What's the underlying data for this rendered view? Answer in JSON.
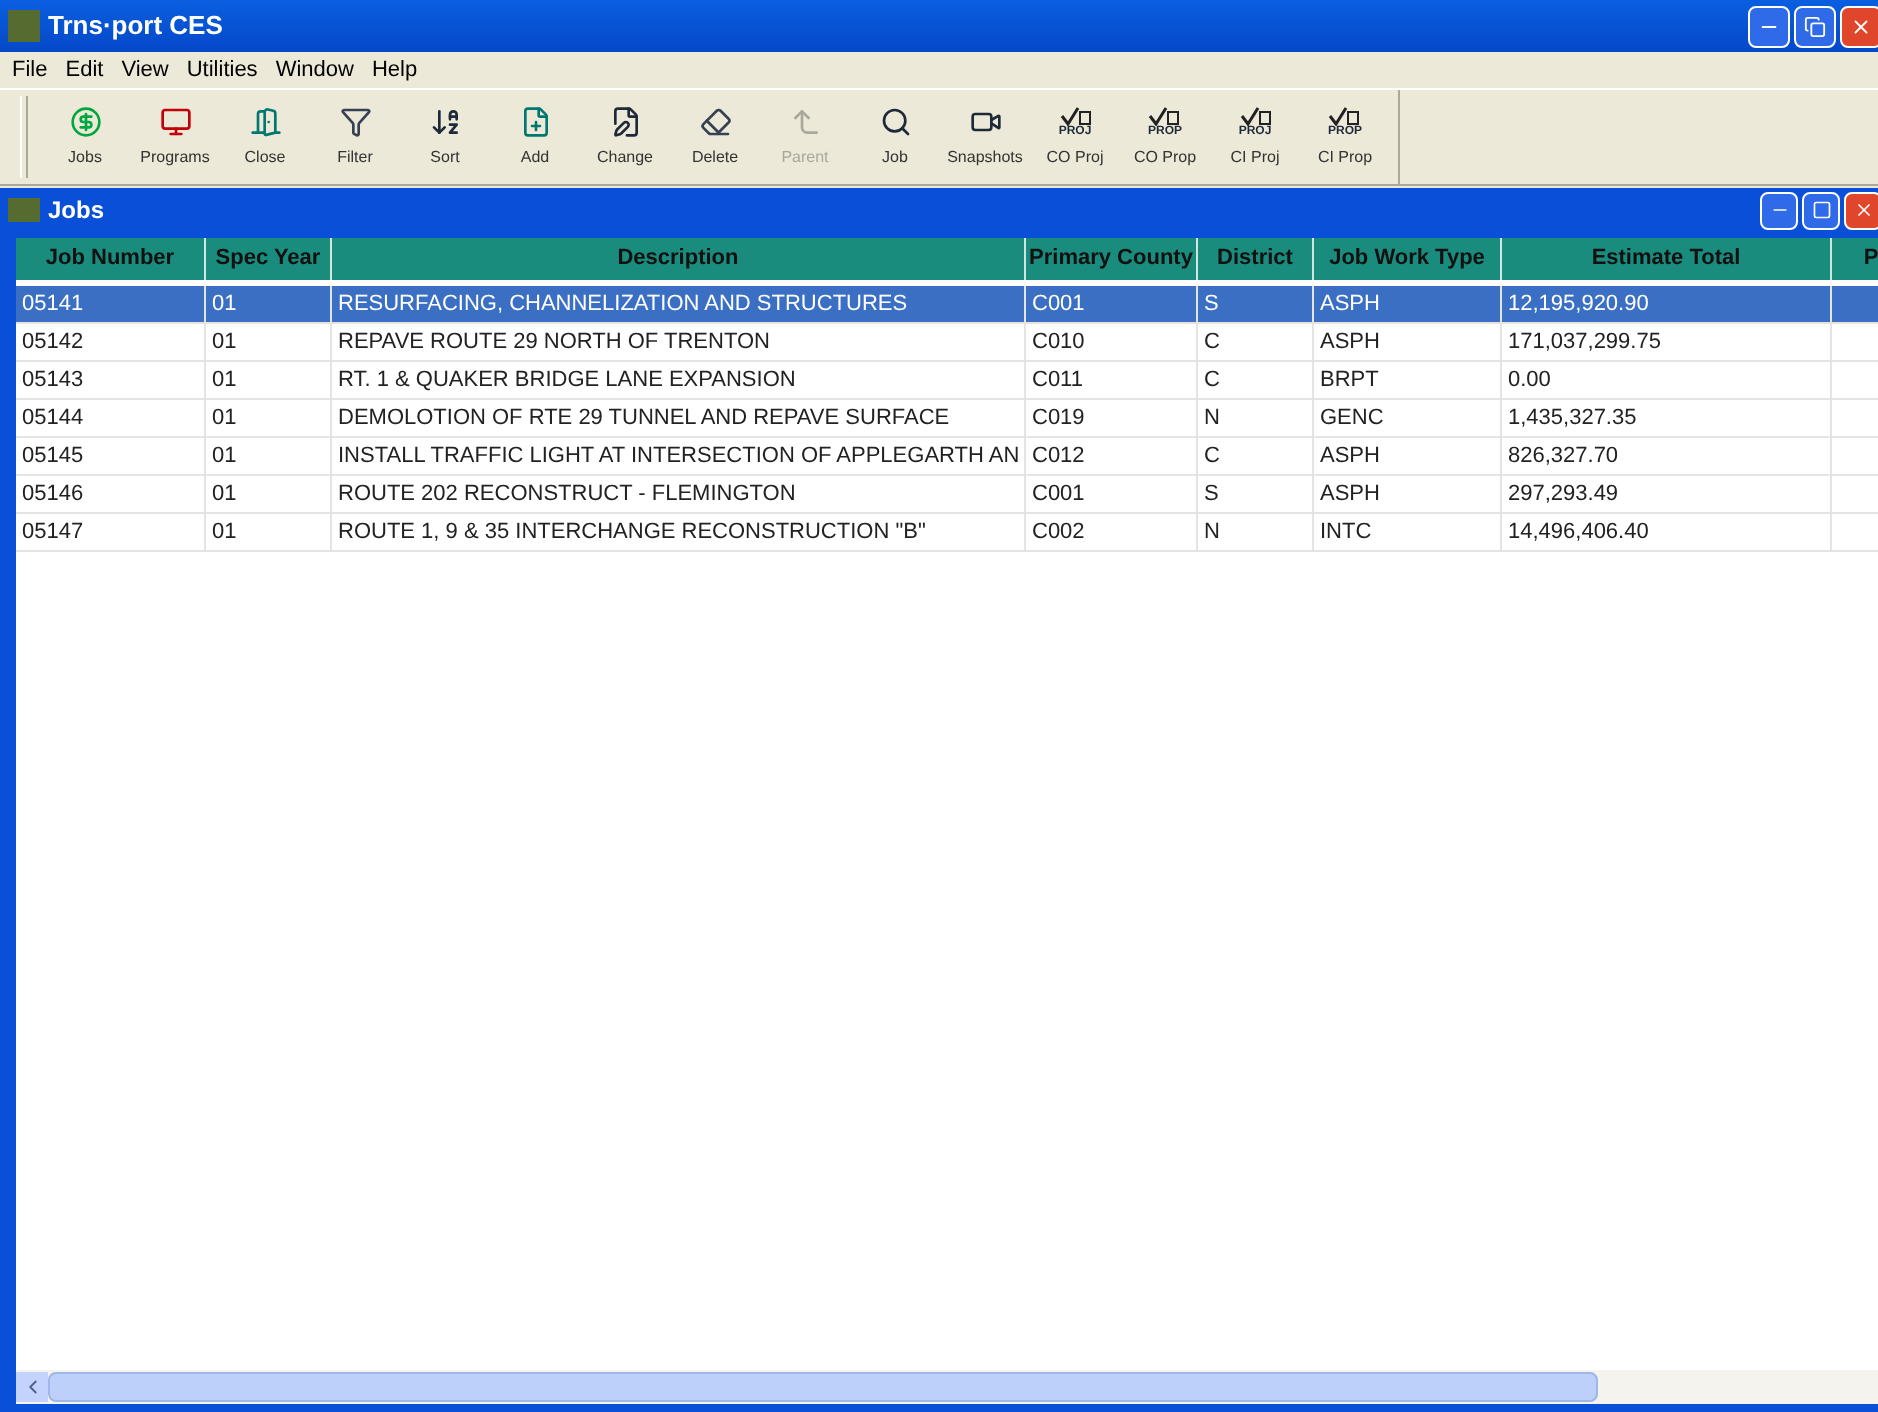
{
  "window": {
    "title": "Trns·port CES"
  },
  "menu": [
    "File",
    "Edit",
    "View",
    "Utilities",
    "Window",
    "Help"
  ],
  "toolbar": [
    {
      "label": "Jobs",
      "disabled": false
    },
    {
      "label": "Programs",
      "disabled": false
    },
    {
      "label": "Close",
      "disabled": false
    },
    {
      "label": "Filter",
      "disabled": false
    },
    {
      "label": "Sort",
      "disabled": false
    },
    {
      "label": "Add",
      "disabled": false
    },
    {
      "label": "Change",
      "disabled": false
    },
    {
      "label": "Delete",
      "disabled": false
    },
    {
      "label": "Parent",
      "disabled": true
    },
    {
      "label": "Job",
      "disabled": false
    },
    {
      "label": "Snapshots",
      "disabled": false
    },
    {
      "label": "CO Proj",
      "icon_caption": "PROJ",
      "disabled": false
    },
    {
      "label": "CO Prop",
      "icon_caption": "PROP",
      "disabled": false
    },
    {
      "label": "CI Proj",
      "icon_caption": "PROJ",
      "disabled": false
    },
    {
      "label": "CI Prop",
      "icon_caption": "PROP",
      "disabled": false
    }
  ],
  "child_window": {
    "title": "Jobs"
  },
  "table": {
    "columns": [
      "Job Number",
      "Spec Year",
      "Description",
      "Primary County",
      "District",
      "Job Work Type",
      "Estimate Total",
      "P"
    ],
    "rows": [
      {
        "selected": true,
        "cells": [
          "05141",
          "01",
          "RESURFACING, CHANNELIZATION AND STRUCTURES",
          "C001",
          "S",
          "ASPH",
          "12,195,920.90"
        ]
      },
      {
        "selected": false,
        "cells": [
          "05142",
          "01",
          "REPAVE ROUTE 29 NORTH OF TRENTON",
          "C010",
          "C",
          "ASPH",
          "171,037,299.75"
        ]
      },
      {
        "selected": false,
        "cells": [
          "05143",
          "01",
          "RT. 1 & QUAKER BRIDGE LANE EXPANSION",
          "C011",
          "C",
          "BRPT",
          "0.00"
        ]
      },
      {
        "selected": false,
        "cells": [
          "05144",
          "01",
          "DEMOLOTION OF RTE 29 TUNNEL AND REPAVE SURFACE",
          "C019",
          "N",
          "GENC",
          "1,435,327.35"
        ]
      },
      {
        "selected": false,
        "cells": [
          "05145",
          "01",
          "INSTALL TRAFFIC LIGHT AT INTERSECTION OF APPLEGARTH AN",
          "C012",
          "C",
          "ASPH",
          "826,327.70"
        ]
      },
      {
        "selected": false,
        "cells": [
          "05146",
          "01",
          "ROUTE 202 RECONSTRUCT - FLEMINGTON",
          "C001",
          "S",
          "ASPH",
          "297,293.49"
        ]
      },
      {
        "selected": false,
        "cells": [
          "05147",
          "01",
          "ROUTE 1, 9 & 35 INTERCHANGE RECONSTRUCTION \"B\"",
          "C002",
          "N",
          "INTC",
          "14,496,406.40"
        ]
      }
    ]
  }
}
